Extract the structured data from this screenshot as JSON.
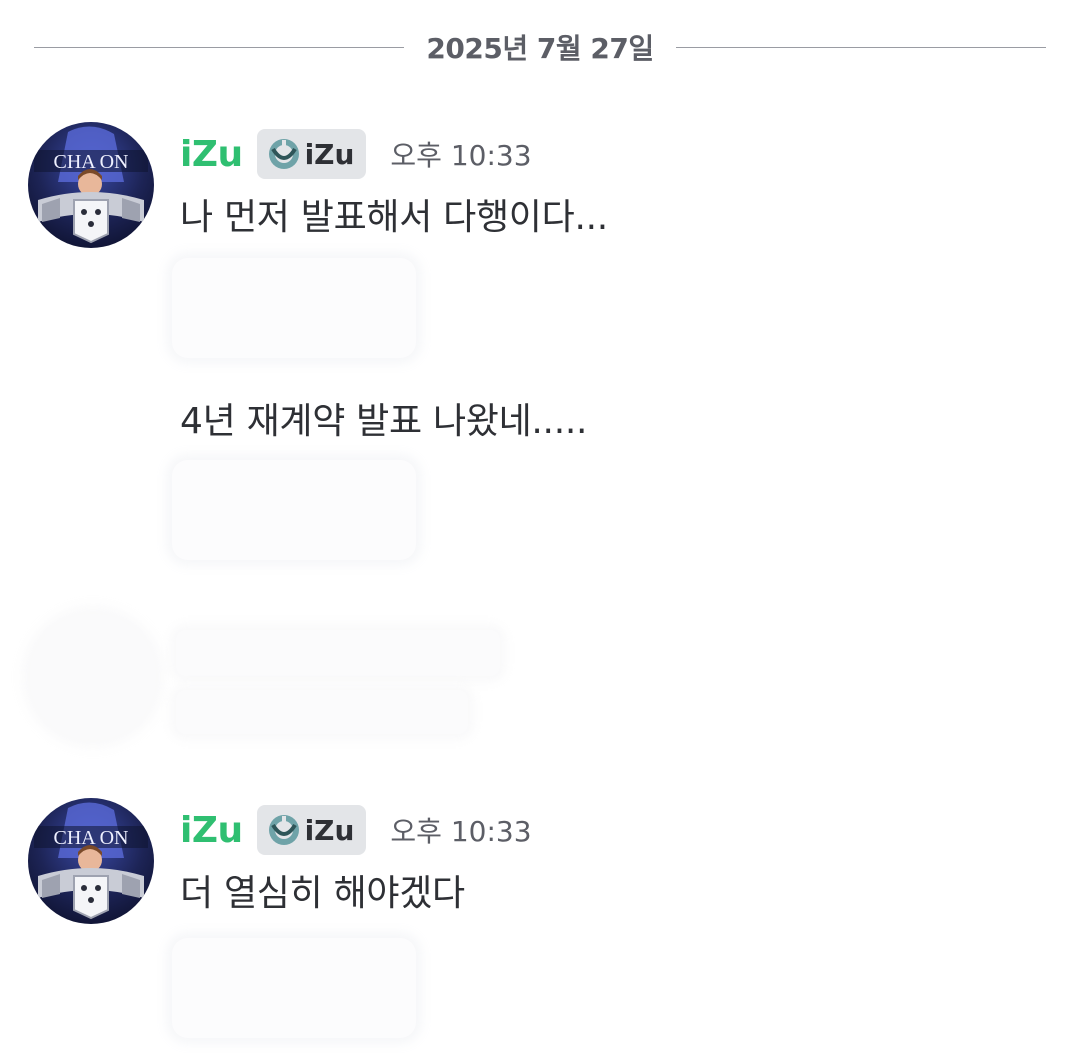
{
  "date_divider": {
    "text": "2025년 7월 27일"
  },
  "messages": [
    {
      "username": "iZu",
      "tag_label": "iZu",
      "timestamp": "오후 10:33",
      "texts": [
        "나 먼저 발표해서 다행이다...",
        "4년 재계약 발표 나왔네....."
      ]
    },
    {
      "username": "iZu",
      "tag_label": "iZu",
      "timestamp": "오후 10:33",
      "texts": [
        "더 열심히 해야겠다"
      ]
    }
  ],
  "colors": {
    "username": "#2fbf71",
    "text": "#2e3035",
    "muted": "#5c5e66",
    "tag_bg": "#e3e5e8",
    "divider": "#9a9ca3"
  },
  "icons": {
    "avatar": "profile-avatar-icon",
    "tag": "guild-tag-icon"
  }
}
